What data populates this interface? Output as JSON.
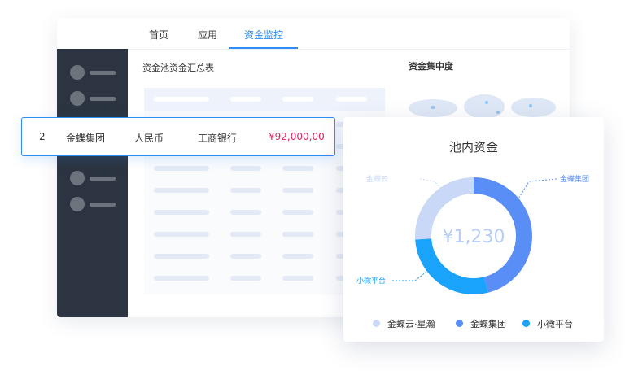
{
  "nav": {
    "tabs": [
      {
        "label": "首页",
        "active": false
      },
      {
        "label": "应用",
        "active": false
      },
      {
        "label": "资金监控",
        "active": true
      }
    ]
  },
  "main": {
    "table_title": "资金池资金汇总表",
    "map_title": "资金集中度"
  },
  "highlight_row": {
    "index": "2",
    "company": "金蝶集团",
    "currency": "人民币",
    "bank": "工商银行",
    "amount": "¥92,000,00"
  },
  "pool_card": {
    "title": "池内资金",
    "center_value": "¥1,230",
    "callouts": {
      "left_top": "金蝶云",
      "right_top": "金蝶集团",
      "left_bottom": "小微平台"
    },
    "legend": [
      {
        "label": "金蝶云·星瀚",
        "color": "#c9d8f6"
      },
      {
        "label": "金蝶集团",
        "color": "#5a8ef7"
      },
      {
        "label": "小微平台",
        "color": "#1aa3fb"
      }
    ]
  },
  "chart_data": {
    "type": "pie",
    "title": "池内资金",
    "center_label": "¥1,230",
    "labels": [
      "金蝶集团",
      "小微平台",
      "金蝶云·星瀚"
    ],
    "values": [
      46,
      28,
      26
    ],
    "colors": [
      "#5a8ef7",
      "#1aa3fb",
      "#c9d8f6"
    ],
    "legend": "bottom"
  },
  "colors": {
    "accent": "#2f8df5",
    "sidebar": "#2b3440",
    "amount": "#e0245e"
  }
}
